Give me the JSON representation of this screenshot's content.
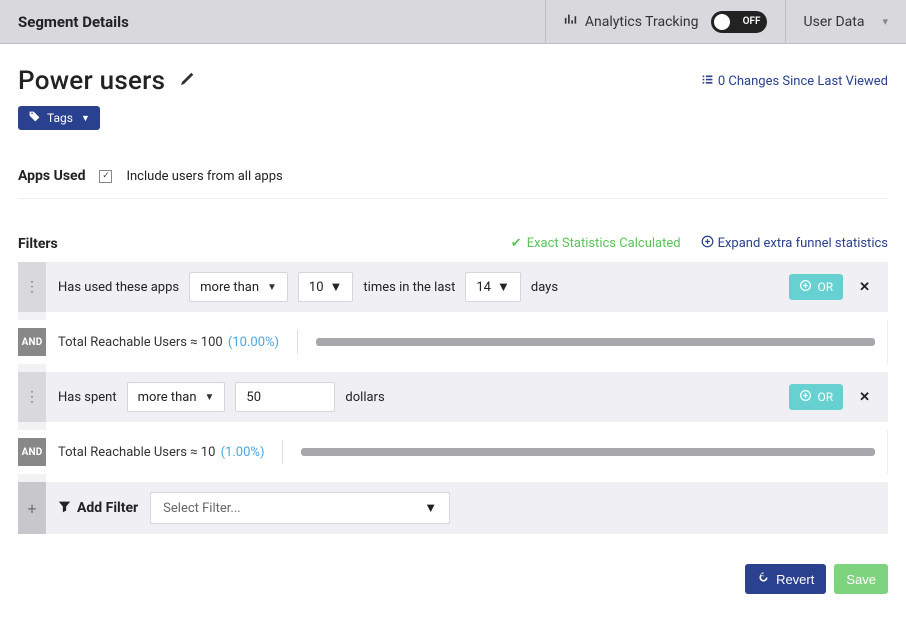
{
  "header": {
    "title": "Segment Details",
    "tracking_label": "Analytics Tracking",
    "tracking_state": "OFF",
    "userdata_label": "User Data"
  },
  "segment": {
    "name": "Power users",
    "changes_text": "0 Changes Since Last Viewed",
    "tags_button": "Tags"
  },
  "apps": {
    "section_label": "Apps Used",
    "include_all_label": "Include users from all apps",
    "include_all_checked": true
  },
  "filters": {
    "section_label": "Filters",
    "stat_calc": "Exact Statistics Calculated",
    "expand_label": "Expand extra funnel statistics",
    "and_label": "AND",
    "or_label": "OR",
    "rules": [
      {
        "pre": "Has used these apps",
        "op": "more than",
        "value": "10",
        "mid": "times in the last",
        "value2": "14",
        "post": "days",
        "reach_prefix": "Total Reachable Users ≈ ",
        "reach_number": "100",
        "reach_pct": "(10.00%)"
      },
      {
        "pre": "Has spent",
        "op": "more than",
        "value": "50",
        "post": "dollars",
        "reach_prefix": "Total Reachable Users ≈ ",
        "reach_number": "10",
        "reach_pct": "(1.00%)"
      }
    ],
    "add": {
      "label": "Add Filter",
      "placeholder": "Select Filter..."
    }
  },
  "footer": {
    "revert": "Revert",
    "save": "Save"
  }
}
